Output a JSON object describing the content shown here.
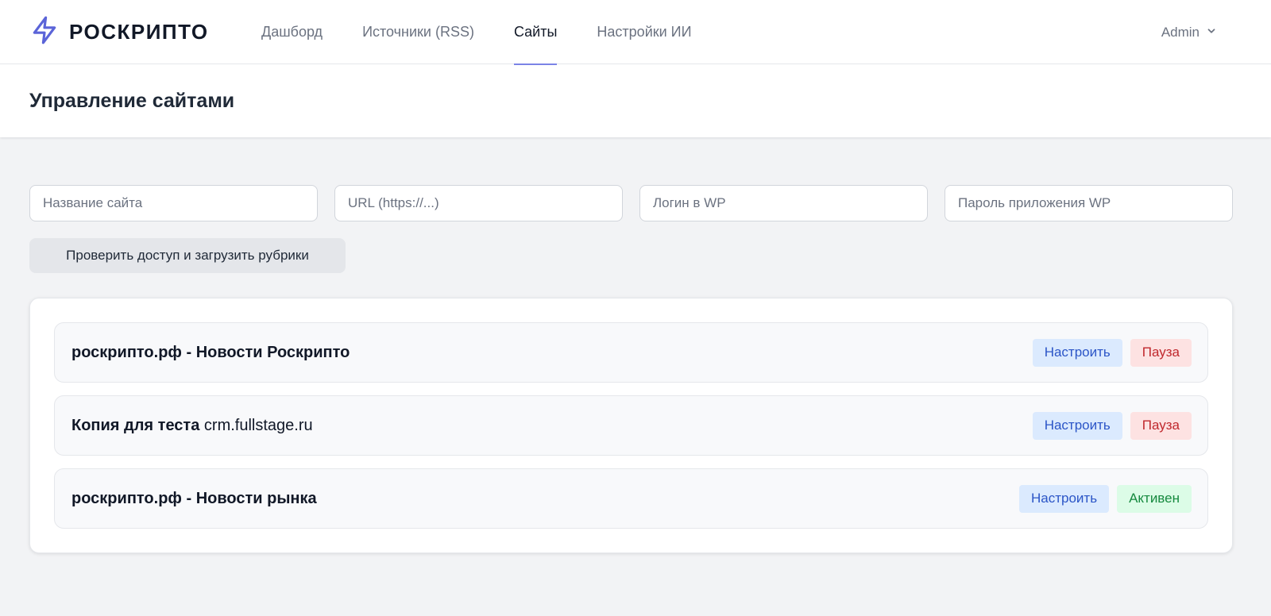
{
  "brand": {
    "name": "РОСКРИПТО",
    "accent": "#5b64d8"
  },
  "nav": {
    "items": [
      {
        "label": "Дашборд",
        "active": false
      },
      {
        "label": "Источники (RSS)",
        "active": false
      },
      {
        "label": "Сайты",
        "active": true
      },
      {
        "label": "Настройки ИИ",
        "active": false
      }
    ]
  },
  "user": {
    "name": "Admin"
  },
  "page": {
    "title": "Управление сайтами"
  },
  "form": {
    "site_name_placeholder": "Название сайта",
    "url_placeholder": "URL (https://...)",
    "login_placeholder": "Логин в WP",
    "password_placeholder": "Пароль приложения WP",
    "check_button": "Проверить доступ и загрузить рубрики"
  },
  "sites": [
    {
      "name": "роскрипто.рф - Новости Роскрипто",
      "domain": "",
      "configure": "Настроить",
      "status": "Пауза",
      "status_type": "pause"
    },
    {
      "name": "Копия для теста",
      "domain": " crm.fullstage.ru",
      "configure": "Настроить",
      "status": "Пауза",
      "status_type": "pause"
    },
    {
      "name": "роскрипто.рф - Новости рынка",
      "domain": "",
      "configure": "Настроить",
      "status": "Активен",
      "status_type": "active"
    }
  ],
  "colors": {
    "nav_active_underline": "#7b83e6",
    "config_bg": "#dbeafe",
    "pause_bg": "#fde2e2",
    "active_bg": "#dcfce7"
  },
  "icons": {
    "logo": "lightning-bolt-icon",
    "user_menu": "chevron-down-icon"
  }
}
